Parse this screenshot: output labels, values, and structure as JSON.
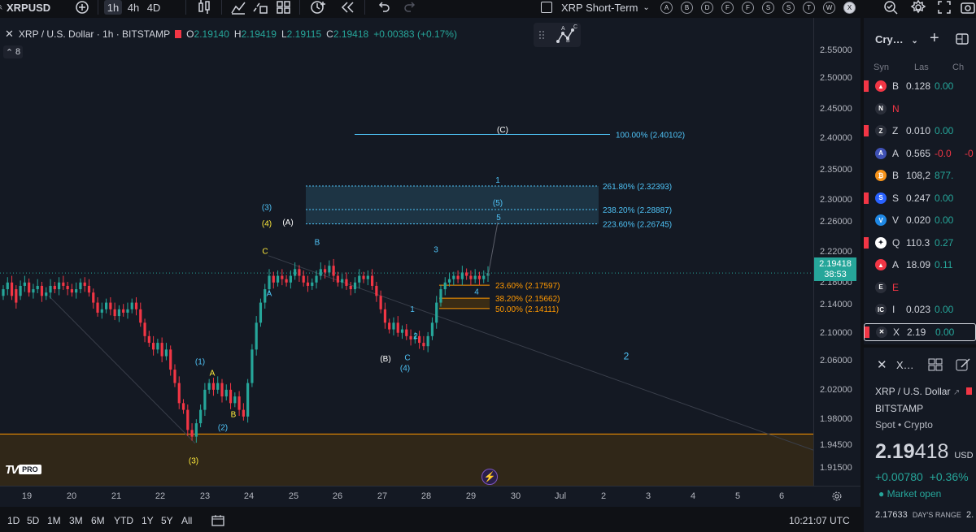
{
  "topbar": {
    "symbol": "XRPUSD",
    "intervals": [
      "1h",
      "4h",
      "4D"
    ],
    "layout_name": "XRP Short-Term",
    "alert_letters": [
      "A",
      "B",
      "D",
      "F",
      "F",
      "S",
      "S",
      "T",
      "W",
      "X"
    ]
  },
  "legend": {
    "title": "XRP / U.S. Dollar · 1h · BITSTAMP",
    "o_label": "O",
    "o_value": "2.19140",
    "h_label": "H",
    "h_value": "2.19419",
    "l_label": "L",
    "l_value": "2.19115",
    "c_label": "C",
    "c_value": "2.19418",
    "change": "+0.00383 (+0.17%)",
    "collapsed_count": "8"
  },
  "abc_tool": {
    "a": "A",
    "b": "B",
    "c": "C"
  },
  "logo": {
    "text": "TV",
    "badge": "PRO"
  },
  "price_axis": {
    "ticks": [
      "2.55000",
      "2.50000",
      "2.45000",
      "2.40000",
      "2.35000",
      "2.30000",
      "2.26000",
      "2.22000",
      "2.18000",
      "2.14000",
      "2.10000",
      "2.06000",
      "2.02000",
      "1.98000",
      "1.94500",
      "1.91500"
    ],
    "current_price": "2.19418",
    "countdown": "38:53"
  },
  "time_axis": {
    "ticks": [
      "19",
      "20",
      "21",
      "22",
      "23",
      "24",
      "25",
      "26",
      "27",
      "28",
      "29",
      "30",
      "Jul",
      "2",
      "3",
      "4",
      "5",
      "6"
    ]
  },
  "fib_levels": [
    {
      "label": "100.00% (2.40102)",
      "color": "#4fc3f7"
    },
    {
      "label": "261.80% (2.32393)",
      "color": "#4fc3f7"
    },
    {
      "label": "238.20% (2.28887)",
      "color": "#4fc3f7"
    },
    {
      "label": "223.60% (2.26745)",
      "color": "#4fc3f7"
    },
    {
      "label": "23.60% (2.17597)",
      "color": "#ff9800"
    },
    {
      "label": "38.20% (2.15662)",
      "color": "#ff9800"
    },
    {
      "label": "50.00% (2.14111)",
      "color": "#ff9800"
    }
  ],
  "wave_labels": [
    {
      "t": "(3)",
      "c": "#4fc3f7"
    },
    {
      "t": "(4)",
      "c": "#ffeb3b"
    },
    {
      "t": "C",
      "c": "#ffeb3b"
    },
    {
      "t": "(A)",
      "c": "#ffffff"
    },
    {
      "t": "B",
      "c": "#4fc3f7"
    },
    {
      "t": "A",
      "c": "#4fc3f7"
    },
    {
      "t": "(1)",
      "c": "#4fc3f7"
    },
    {
      "t": "A",
      "c": "#ffeb3b"
    },
    {
      "t": "B",
      "c": "#ffeb3b"
    },
    {
      "t": "(2)",
      "c": "#4fc3f7"
    },
    {
      "t": "(3)",
      "c": "#ffeb3b"
    },
    {
      "t": "(B)",
      "c": "#ffffff"
    },
    {
      "t": "C",
      "c": "#4fc3f7"
    },
    {
      "t": "(4)",
      "c": "#4fc3f7"
    },
    {
      "t": "1",
      "c": "#4fc3f7"
    },
    {
      "t": "2",
      "c": "#4fc3f7"
    },
    {
      "t": "3",
      "c": "#4fc3f7"
    },
    {
      "t": "4",
      "c": "#4fc3f7"
    },
    {
      "t": "(C)",
      "c": "#ffffff"
    },
    {
      "t": "1",
      "c": "#4fc3f7"
    },
    {
      "t": "(5)",
      "c": "#4fc3f7"
    },
    {
      "t": "5",
      "c": "#4fc3f7"
    },
    {
      "t": "2",
      "c": "#4fc3f7"
    }
  ],
  "bottombar": {
    "ranges": [
      "1D",
      "5D",
      "1M",
      "3M",
      "6M",
      "YTD",
      "1Y",
      "5Y",
      "All"
    ],
    "clock": "10:21:07 UTC"
  },
  "watchlist": {
    "title": "Cry…",
    "col_symbol": "Syn",
    "col_last": "Las",
    "col_chg": "Ch",
    "rows": [
      {
        "sym": "B",
        "last": "0.128",
        "chg": "0.00",
        "chgp": "",
        "ico": "#f23645",
        "icotxt": "▲",
        "dir": "pos",
        "flag": true
      },
      {
        "sym": "N",
        "last": "",
        "chg": "",
        "chgp": "",
        "ico": "#2a2e39",
        "icotxt": "N",
        "dir": "neg",
        "flag": false
      },
      {
        "sym": "Z",
        "last": "0.010",
        "chg": "0.00",
        "chgp": "",
        "ico": "#2a2e39",
        "icotxt": "Z",
        "dir": "pos",
        "flag": true
      },
      {
        "sym": "A",
        "last": "0.565",
        "chg": "-0.0",
        "chgp": "-0",
        "ico": "#3f51b5",
        "icotxt": "A",
        "dir": "neg",
        "flag": false
      },
      {
        "sym": "B",
        "last": "108,2",
        "chg": "877.",
        "chgp": "",
        "ico": "#f7931a",
        "icotxt": "₿",
        "dir": "pos",
        "flag": false
      },
      {
        "sym": "S",
        "last": "0.247",
        "chg": "0.00",
        "chgp": "",
        "ico": "#2962ff",
        "icotxt": "S",
        "dir": "pos",
        "flag": true
      },
      {
        "sym": "V",
        "last": "0.020",
        "chg": "0.00",
        "chgp": "",
        "ico": "#1e88e5",
        "icotxt": "V",
        "dir": "pos",
        "flag": false
      },
      {
        "sym": "Q",
        "last": "110.3",
        "chg": "0.27",
        "chgp": "",
        "ico": "#ffffff",
        "icotxt": "✦",
        "dir": "pos",
        "flag": true
      },
      {
        "sym": "A",
        "last": "18.09",
        "chg": "0.11",
        "chgp": "",
        "ico": "#f23645",
        "icotxt": "▲",
        "dir": "pos",
        "flag": false
      },
      {
        "sym": "E",
        "last": "",
        "chg": "",
        "chgp": "",
        "ico": "#2a2e39",
        "icotxt": "E",
        "dir": "neg",
        "flag": false
      },
      {
        "sym": "I",
        "last": "0.023",
        "chg": "0.00",
        "chgp": "",
        "ico": "#2a2e39",
        "icotxt": "IC",
        "dir": "pos",
        "flag": false
      },
      {
        "sym": "X",
        "last": "2.19",
        "chg": "0.00",
        "chgp": "",
        "ico": "#2a2e39",
        "icotxt": "✕",
        "dir": "pos",
        "flag": true
      }
    ]
  },
  "details": {
    "short_sym": "X…",
    "name": "XRP / U.S. Dollar",
    "exchange": "BITSTAMP",
    "type": "Spot • Crypto",
    "price_main": "2.19",
    "price_tail": "418",
    "currency": "USD",
    "change": "+0.00780",
    "change_pct": "+0.36%",
    "market_status": "Market open",
    "range_low": "2.17633",
    "range_label": "DAY'S RANGE",
    "range_high": "2."
  },
  "colors": {
    "up": "#26a69a",
    "down": "#f23645",
    "fib_blue": "#4fc3f7",
    "fib_orange": "#ff9800",
    "support_zone": "#3a2c15"
  }
}
